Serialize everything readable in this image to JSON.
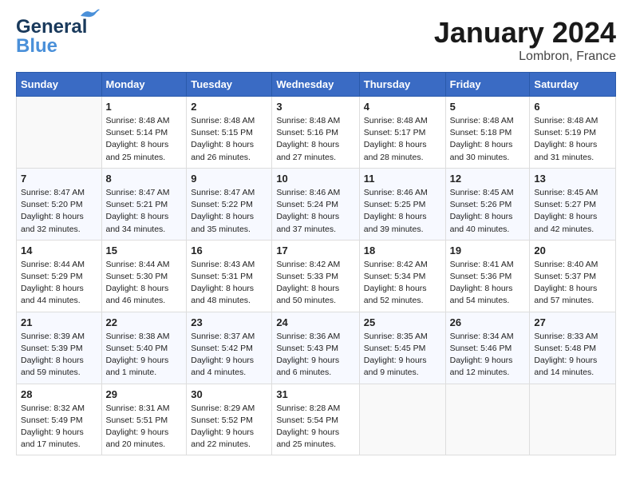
{
  "header": {
    "logo_line1": "General",
    "logo_line2": "Blue",
    "month": "January 2024",
    "location": "Lombron, France"
  },
  "days_header": [
    "Sunday",
    "Monday",
    "Tuesday",
    "Wednesday",
    "Thursday",
    "Friday",
    "Saturday"
  ],
  "weeks": [
    [
      {
        "num": "",
        "sunrise": "",
        "sunset": "",
        "daylight": ""
      },
      {
        "num": "1",
        "sunrise": "Sunrise: 8:48 AM",
        "sunset": "Sunset: 5:14 PM",
        "daylight": "Daylight: 8 hours and 25 minutes."
      },
      {
        "num": "2",
        "sunrise": "Sunrise: 8:48 AM",
        "sunset": "Sunset: 5:15 PM",
        "daylight": "Daylight: 8 hours and 26 minutes."
      },
      {
        "num": "3",
        "sunrise": "Sunrise: 8:48 AM",
        "sunset": "Sunset: 5:16 PM",
        "daylight": "Daylight: 8 hours and 27 minutes."
      },
      {
        "num": "4",
        "sunrise": "Sunrise: 8:48 AM",
        "sunset": "Sunset: 5:17 PM",
        "daylight": "Daylight: 8 hours and 28 minutes."
      },
      {
        "num": "5",
        "sunrise": "Sunrise: 8:48 AM",
        "sunset": "Sunset: 5:18 PM",
        "daylight": "Daylight: 8 hours and 30 minutes."
      },
      {
        "num": "6",
        "sunrise": "Sunrise: 8:48 AM",
        "sunset": "Sunset: 5:19 PM",
        "daylight": "Daylight: 8 hours and 31 minutes."
      }
    ],
    [
      {
        "num": "7",
        "sunrise": "Sunrise: 8:47 AM",
        "sunset": "Sunset: 5:20 PM",
        "daylight": "Daylight: 8 hours and 32 minutes."
      },
      {
        "num": "8",
        "sunrise": "Sunrise: 8:47 AM",
        "sunset": "Sunset: 5:21 PM",
        "daylight": "Daylight: 8 hours and 34 minutes."
      },
      {
        "num": "9",
        "sunrise": "Sunrise: 8:47 AM",
        "sunset": "Sunset: 5:22 PM",
        "daylight": "Daylight: 8 hours and 35 minutes."
      },
      {
        "num": "10",
        "sunrise": "Sunrise: 8:46 AM",
        "sunset": "Sunset: 5:24 PM",
        "daylight": "Daylight: 8 hours and 37 minutes."
      },
      {
        "num": "11",
        "sunrise": "Sunrise: 8:46 AM",
        "sunset": "Sunset: 5:25 PM",
        "daylight": "Daylight: 8 hours and 39 minutes."
      },
      {
        "num": "12",
        "sunrise": "Sunrise: 8:45 AM",
        "sunset": "Sunset: 5:26 PM",
        "daylight": "Daylight: 8 hours and 40 minutes."
      },
      {
        "num": "13",
        "sunrise": "Sunrise: 8:45 AM",
        "sunset": "Sunset: 5:27 PM",
        "daylight": "Daylight: 8 hours and 42 minutes."
      }
    ],
    [
      {
        "num": "14",
        "sunrise": "Sunrise: 8:44 AM",
        "sunset": "Sunset: 5:29 PM",
        "daylight": "Daylight: 8 hours and 44 minutes."
      },
      {
        "num": "15",
        "sunrise": "Sunrise: 8:44 AM",
        "sunset": "Sunset: 5:30 PM",
        "daylight": "Daylight: 8 hours and 46 minutes."
      },
      {
        "num": "16",
        "sunrise": "Sunrise: 8:43 AM",
        "sunset": "Sunset: 5:31 PM",
        "daylight": "Daylight: 8 hours and 48 minutes."
      },
      {
        "num": "17",
        "sunrise": "Sunrise: 8:42 AM",
        "sunset": "Sunset: 5:33 PM",
        "daylight": "Daylight: 8 hours and 50 minutes."
      },
      {
        "num": "18",
        "sunrise": "Sunrise: 8:42 AM",
        "sunset": "Sunset: 5:34 PM",
        "daylight": "Daylight: 8 hours and 52 minutes."
      },
      {
        "num": "19",
        "sunrise": "Sunrise: 8:41 AM",
        "sunset": "Sunset: 5:36 PM",
        "daylight": "Daylight: 8 hours and 54 minutes."
      },
      {
        "num": "20",
        "sunrise": "Sunrise: 8:40 AM",
        "sunset": "Sunset: 5:37 PM",
        "daylight": "Daylight: 8 hours and 57 minutes."
      }
    ],
    [
      {
        "num": "21",
        "sunrise": "Sunrise: 8:39 AM",
        "sunset": "Sunset: 5:39 PM",
        "daylight": "Daylight: 8 hours and 59 minutes."
      },
      {
        "num": "22",
        "sunrise": "Sunrise: 8:38 AM",
        "sunset": "Sunset: 5:40 PM",
        "daylight": "Daylight: 9 hours and 1 minute."
      },
      {
        "num": "23",
        "sunrise": "Sunrise: 8:37 AM",
        "sunset": "Sunset: 5:42 PM",
        "daylight": "Daylight: 9 hours and 4 minutes."
      },
      {
        "num": "24",
        "sunrise": "Sunrise: 8:36 AM",
        "sunset": "Sunset: 5:43 PM",
        "daylight": "Daylight: 9 hours and 6 minutes."
      },
      {
        "num": "25",
        "sunrise": "Sunrise: 8:35 AM",
        "sunset": "Sunset: 5:45 PM",
        "daylight": "Daylight: 9 hours and 9 minutes."
      },
      {
        "num": "26",
        "sunrise": "Sunrise: 8:34 AM",
        "sunset": "Sunset: 5:46 PM",
        "daylight": "Daylight: 9 hours and 12 minutes."
      },
      {
        "num": "27",
        "sunrise": "Sunrise: 8:33 AM",
        "sunset": "Sunset: 5:48 PM",
        "daylight": "Daylight: 9 hours and 14 minutes."
      }
    ],
    [
      {
        "num": "28",
        "sunrise": "Sunrise: 8:32 AM",
        "sunset": "Sunset: 5:49 PM",
        "daylight": "Daylight: 9 hours and 17 minutes."
      },
      {
        "num": "29",
        "sunrise": "Sunrise: 8:31 AM",
        "sunset": "Sunset: 5:51 PM",
        "daylight": "Daylight: 9 hours and 20 minutes."
      },
      {
        "num": "30",
        "sunrise": "Sunrise: 8:29 AM",
        "sunset": "Sunset: 5:52 PM",
        "daylight": "Daylight: 9 hours and 22 minutes."
      },
      {
        "num": "31",
        "sunrise": "Sunrise: 8:28 AM",
        "sunset": "Sunset: 5:54 PM",
        "daylight": "Daylight: 9 hours and 25 minutes."
      },
      {
        "num": "",
        "sunrise": "",
        "sunset": "",
        "daylight": ""
      },
      {
        "num": "",
        "sunrise": "",
        "sunset": "",
        "daylight": ""
      },
      {
        "num": "",
        "sunrise": "",
        "sunset": "",
        "daylight": ""
      }
    ]
  ]
}
